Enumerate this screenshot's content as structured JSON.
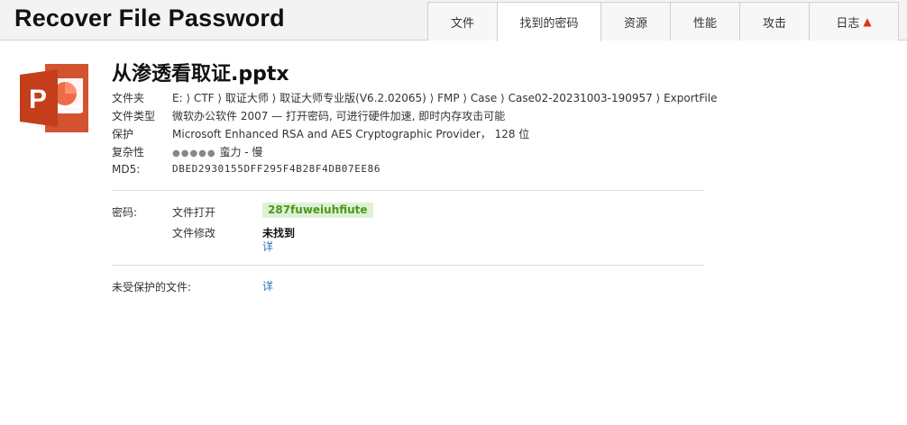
{
  "app": {
    "title": "Recover File Password"
  },
  "tabs": [
    {
      "label": "文件",
      "active": false
    },
    {
      "label": "找到的密码",
      "active": true
    },
    {
      "label": "资源",
      "active": false
    },
    {
      "label": "性能",
      "active": false
    },
    {
      "label": "攻击",
      "active": false
    },
    {
      "label": "日志",
      "active": false,
      "indicator": "▲"
    }
  ],
  "file": {
    "icon": "powerpoint-icon",
    "name": "从渗透看取证.pptx",
    "folder_label": "文件夹",
    "folder_path": "E: ⟩ CTF ⟩ 取证大师 ⟩ 取证大师专业版(V6.2.02065) ⟩ FMP ⟩ Case ⟩ Case02-20231003-190957 ⟩ ExportFile",
    "type_label": "文件类型",
    "type_value": "微软办公软件 2007 — 打开密码, 可进行硬件加速, 即时内存攻击可能",
    "protection_label": "保护",
    "protection_value": "Microsoft Enhanced RSA and AES Cryptographic Provider， 128 位",
    "complexity_label": "复杂性",
    "complexity_dots": "●●●●●",
    "complexity_value": "蛮力 - 慢",
    "md5_label": "MD5:",
    "md5_value": "DBED2930155DFF295F4B28F4DB07EE86"
  },
  "passwords": {
    "label": "密码:",
    "open_label": "文件打开",
    "open_value": "287fuweiuhfiute",
    "modify_label": "文件修改",
    "modify_value": "未找到",
    "details_link": "详"
  },
  "unprotected": {
    "label": "未受保护的文件:",
    "details_link": "详"
  },
  "colors": {
    "accent_green": "#4a9a16",
    "found_bg": "#dff0d8",
    "link": "#2a6fb0",
    "ppt_orange": "#d35230",
    "log_arrow": "#d9341b"
  }
}
